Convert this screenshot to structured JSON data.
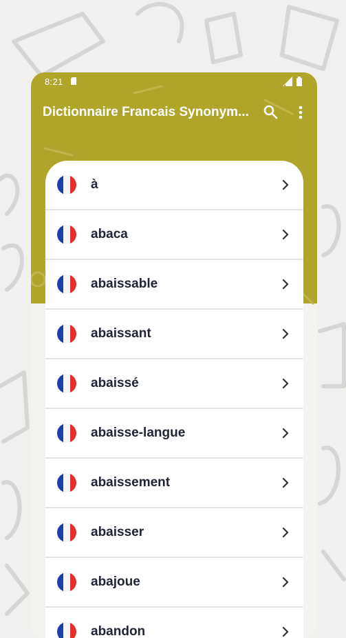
{
  "status_bar": {
    "time": "8:21"
  },
  "app_bar": {
    "title": "Dictionnaire Francais Synonym..."
  },
  "words": [
    "à",
    "abaca",
    "abaissable",
    "abaissant",
    "abaissé",
    "abaisse-langue",
    "abaissement",
    "abaisser",
    "abajoue",
    "abandon"
  ],
  "icons": {
    "search": "search-icon",
    "more": "more-vert-icon",
    "flag": "france-flag-icon",
    "chevron": "chevron-right-icon"
  },
  "colors": {
    "header": "#aea52a",
    "background": "#f1f0ef",
    "text": "#1f2333",
    "flag_blue": "#1d3fa8",
    "flag_red": "#e2312d"
  }
}
